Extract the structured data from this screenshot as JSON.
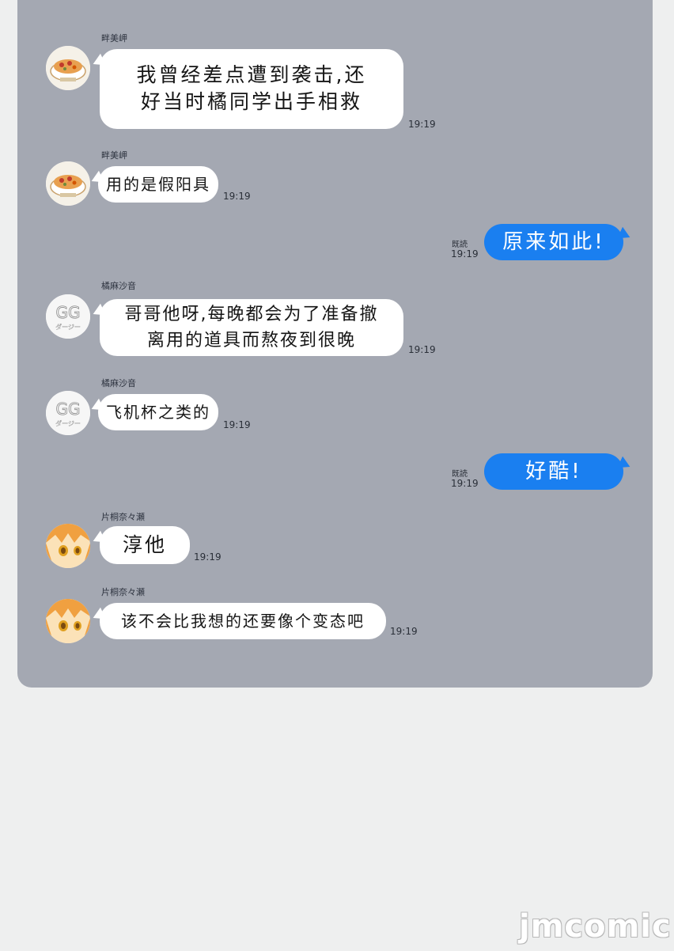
{
  "messages": [
    {
      "sender": "畔美岬",
      "avatar": "food-avatar-icon",
      "text_lines": [
        "我曾经差点遭到袭击,还",
        "好当时橘同学出手相救"
      ],
      "time": "19:19"
    },
    {
      "sender": "畔美岬",
      "avatar": "food-avatar-icon",
      "text_lines": [
        "用的是假阳具"
      ],
      "time": "19:19"
    },
    {
      "outgoing": true,
      "text": "原来如此!",
      "read": "既読",
      "time": "19:19"
    },
    {
      "sender": "橘麻沙音",
      "avatar": "gg-avatar-icon",
      "text_lines": [
        "哥哥他呀,每晚都会为了准备撤",
        "离用的道具而熬夜到很晚"
      ],
      "time": "19:19"
    },
    {
      "sender": "橘麻沙音",
      "avatar": "gg-avatar-icon",
      "text_lines": [
        "飞机杯之类的"
      ],
      "time": "19:19"
    },
    {
      "outgoing": true,
      "text": "好酷!",
      "read": "既読",
      "time": "19:19"
    },
    {
      "sender": "片桐奈々瀬",
      "avatar": "anime-girl-avatar-icon",
      "text_lines": [
        "淳他"
      ],
      "time": "19:19"
    },
    {
      "sender": "片桐奈々瀬",
      "avatar": "anime-girl-avatar-icon",
      "text_lines": [
        "该不会比我想的还要像个变态吧"
      ],
      "time": "19:19"
    }
  ],
  "avatar_gg_text": {
    "top": "GG",
    "bottom": "ダージー"
  },
  "watermark": "jmcomic",
  "colors": {
    "panel": "#a4a8b2",
    "outgoing_bubble": "#1a7ff0",
    "incoming_bubble": "#ffffff",
    "page": "#eeefef"
  }
}
